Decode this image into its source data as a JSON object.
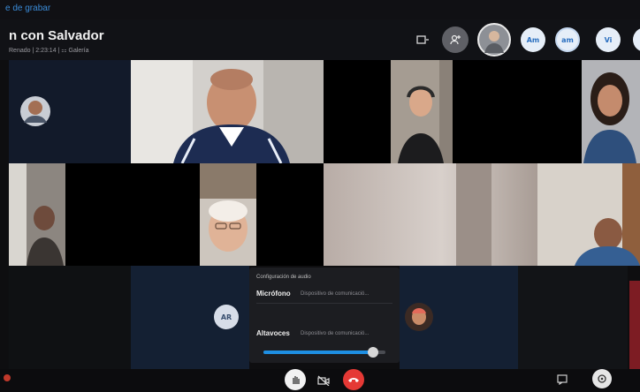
{
  "top_link": "e de grabar",
  "title": "n con Salvador",
  "subtitle": "Renado | 2:23:14 | ⚏ Galería",
  "participants": [
    {
      "initials": "Am",
      "color": "#e6eef8",
      "text_color": "#2b6fbf"
    },
    {
      "initials": "am",
      "color": "#e6eef8",
      "text_color": "#2b6fbf"
    },
    {
      "initials": "Vi",
      "color": "#e6eef8",
      "text_color": "#2b6fbf"
    }
  ],
  "tile_avatar": {
    "initials": "AR"
  },
  "audio_panel": {
    "title": "Configuración de audio",
    "microphone_label": "Micrófono",
    "microphone_value": "Dispositivo de comunicació...",
    "speaker_label": "Altavoces",
    "speaker_value": "Dispositivo de comunicació...",
    "volume_percent": 90
  },
  "colors": {
    "accent": "#1e8fe3",
    "hangup": "#e53935",
    "background": "#0e0e10"
  },
  "icons": [
    "layout-icon",
    "add-person-icon",
    "raise-hand-icon",
    "camera-icon",
    "hang-up-icon",
    "chat-icon",
    "more-icon"
  ]
}
